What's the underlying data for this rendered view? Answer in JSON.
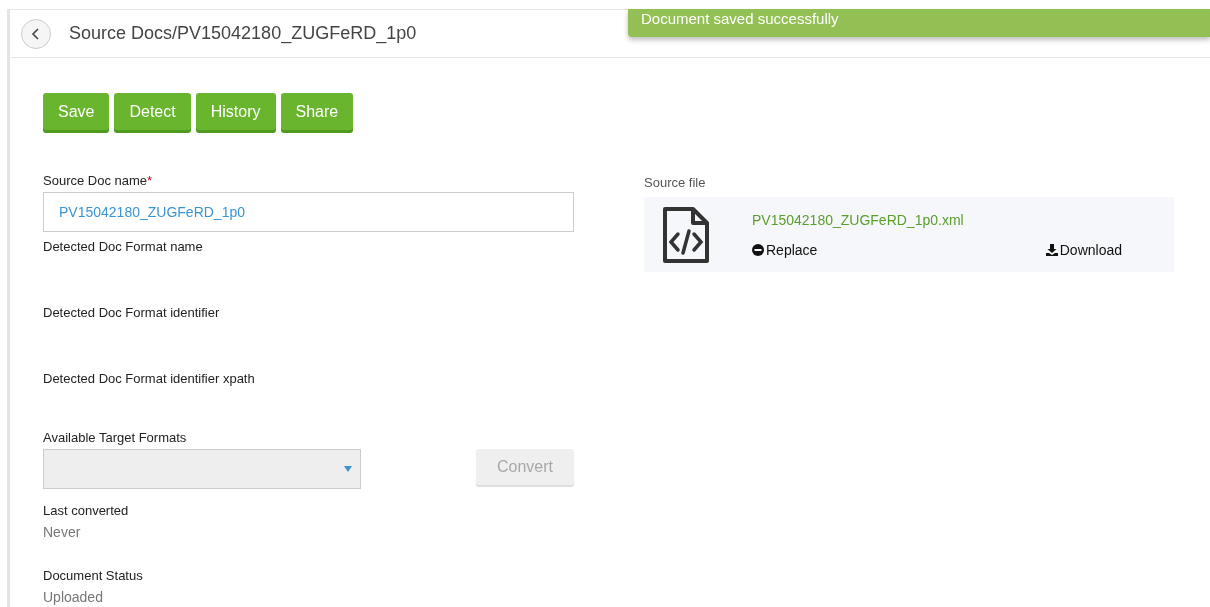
{
  "header": {
    "title": "Source Docs/PV15042180_ZUGFeRD_1p0"
  },
  "toast": {
    "message": "Document saved successfully"
  },
  "actions": [
    "Save",
    "Detect",
    "History",
    "Share"
  ],
  "name_field": {
    "label": "Source Doc name",
    "required_mark": "*",
    "value": "PV15042180_ZUGFeRD_1p0"
  },
  "detected_fields": [
    {
      "label": "Detected Doc Format name"
    },
    {
      "label": "Detected Doc Format identifier"
    },
    {
      "label": "Detected Doc Format identifier xpath"
    }
  ],
  "target_formats": {
    "label": "Available Target Formats",
    "disabled": true
  },
  "convert_button": {
    "label": "Convert",
    "disabled": true
  },
  "info": [
    {
      "label": "Last converted",
      "value": "Never"
    },
    {
      "label": "Document Status",
      "value": "Uploaded"
    }
  ],
  "source_file": {
    "label": "Source file",
    "file_name": "PV15042180_ZUGFeRD_1p0.xml",
    "replace": "Replace",
    "download": "Download"
  }
}
